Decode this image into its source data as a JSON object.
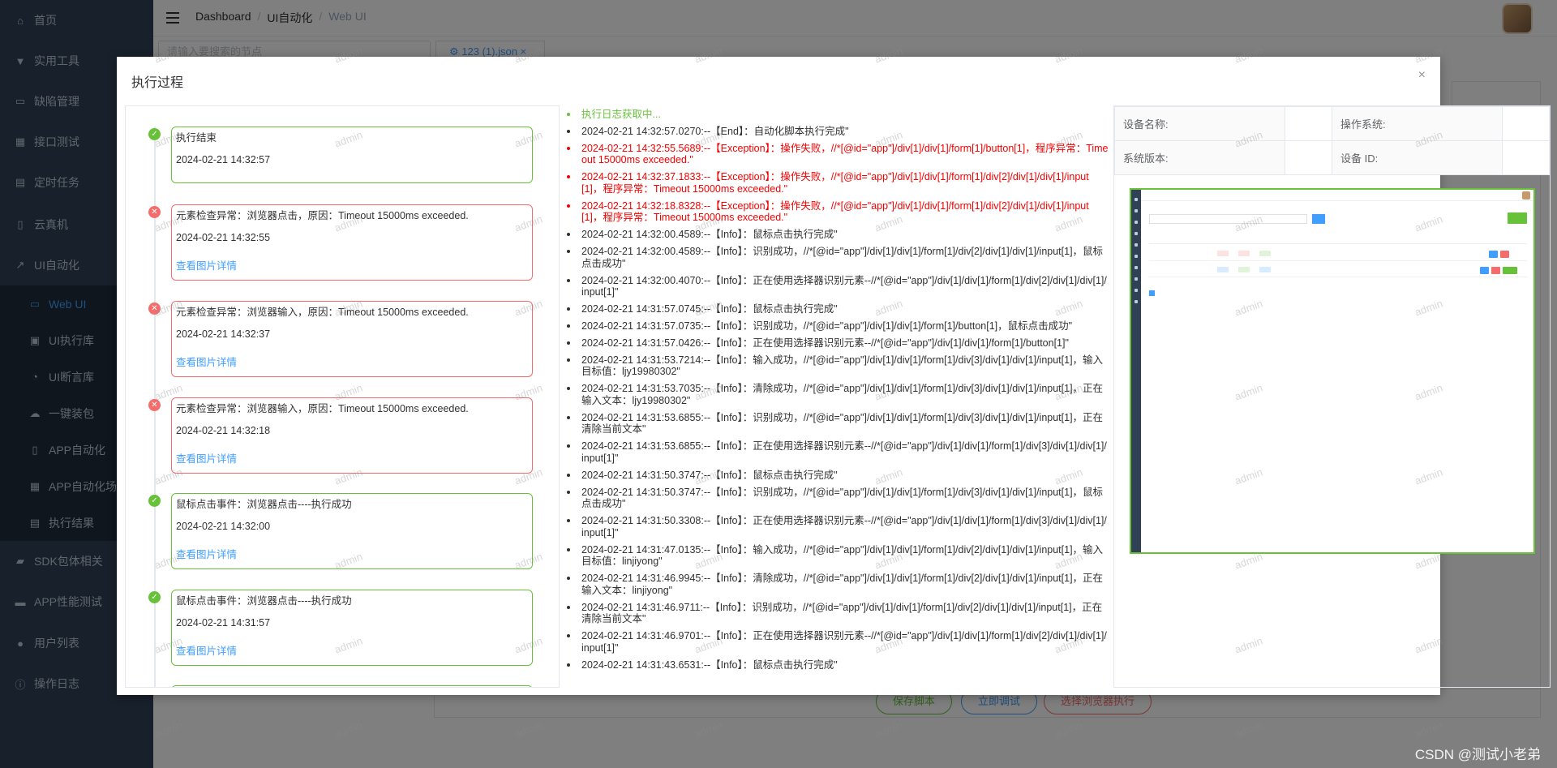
{
  "sidebar": {
    "items": [
      {
        "label": "首页",
        "icon": "home-icon"
      },
      {
        "label": "实用工具",
        "icon": "tools-icon"
      },
      {
        "label": "缺陷管理",
        "icon": "briefcase-icon"
      },
      {
        "label": "接口测试",
        "icon": "grid-icon"
      },
      {
        "label": "定时任务",
        "icon": "clipboard-icon"
      },
      {
        "label": "云真机",
        "icon": "mobile-icon"
      },
      {
        "label": "UI自动化",
        "icon": "chart-icon"
      },
      {
        "label": "Web UI",
        "icon": "monitor-icon"
      },
      {
        "label": "UI执行库",
        "icon": "image-icon"
      },
      {
        "label": "UI断言库",
        "icon": "gauge-icon"
      },
      {
        "label": "一键装包",
        "icon": "cloud-upload-icon"
      },
      {
        "label": "APP自动化",
        "icon": "phone-icon"
      },
      {
        "label": "APP自动化场景",
        "icon": "calendar-icon"
      },
      {
        "label": "执行结果",
        "icon": "clipboard-check-icon"
      },
      {
        "label": "SDK包体相关",
        "icon": "package-icon"
      },
      {
        "label": "APP性能测试",
        "icon": "screen-icon"
      },
      {
        "label": "用户列表",
        "icon": "user-icon"
      },
      {
        "label": "操作日志",
        "icon": "info-icon"
      }
    ]
  },
  "breadcrumb": {
    "items": [
      "Dashboard",
      "UI自动化",
      "Web UI"
    ]
  },
  "background": {
    "search_placeholder": "请输入要搜索的节点",
    "tab_label": "123 (1).json",
    "save_button": "保存脚本",
    "debug_button": "立即调试",
    "browser_button": "选择浏览器执行"
  },
  "watermark": "admin",
  "dialog": {
    "title": "执行过程",
    "close": "×",
    "timeline": [
      {
        "status": "ok",
        "title": "执行结束",
        "date": "2024-02-21 14:32:57",
        "link": ""
      },
      {
        "status": "err",
        "title": "元素检查异常：浏览器点击，原因：Timeout 15000ms exceeded.",
        "date": "2024-02-21 14:32:55",
        "link": "查看图片详情"
      },
      {
        "status": "err",
        "title": "元素检查异常：浏览器输入，原因：Timeout 15000ms exceeded.",
        "date": "2024-02-21 14:32:37",
        "link": "查看图片详情"
      },
      {
        "status": "err",
        "title": "元素检查异常：浏览器输入，原因：Timeout 15000ms exceeded.",
        "date": "2024-02-21 14:32:18",
        "link": "查看图片详情"
      },
      {
        "status": "ok",
        "title": "鼠标点击事件：浏览器点击----执行成功",
        "date": "2024-02-21 14:32:00",
        "link": "查看图片详情"
      },
      {
        "status": "ok",
        "title": "鼠标点击事件：浏览器点击----执行成功",
        "date": "2024-02-21 14:31:57",
        "link": "查看图片详情"
      }
    ],
    "logs": [
      {
        "type": "first",
        "text": "执行日志获取中..."
      },
      {
        "type": "info",
        "text": "2024-02-21 14:32:57.0270:--【End】：自动化脚本执行完成\""
      },
      {
        "type": "err",
        "text": "2024-02-21 14:32:55.5689:--【Exception】：操作失败，//*[@id=\"app\"]/div[1]/div[1]/form[1]/button[1]，程序异常：Timeout 15000ms exceeded.\""
      },
      {
        "type": "err",
        "text": "2024-02-21 14:32:37.1833:--【Exception】：操作失败，//*[@id=\"app\"]/div[1]/div[1]/form[1]/div[2]/div[1]/div[1]/input[1]，程序异常：Timeout 15000ms exceeded.\""
      },
      {
        "type": "err",
        "text": "2024-02-21 14:32:18.8328:--【Exception】：操作失败，//*[@id=\"app\"]/div[1]/div[1]/form[1]/div[2]/div[1]/div[1]/input[1]，程序异常：Timeout 15000ms exceeded.\""
      },
      {
        "type": "info",
        "text": "2024-02-21 14:32:00.4589:--【Info】：鼠标点击执行完成\""
      },
      {
        "type": "info",
        "text": "2024-02-21 14:32:00.4589:--【Info】：识别成功，//*[@id=\"app\"]/div[1]/div[1]/form[1]/div[2]/div[1]/div[1]/input[1]，鼠标点击成功\""
      },
      {
        "type": "info",
        "text": "2024-02-21 14:32:00.4070:--【Info】：正在使用选择器识别元素--//*[@id=\"app\"]/div[1]/div[1]/form[1]/div[2]/div[1]/div[1]/input[1]\""
      },
      {
        "type": "info",
        "text": "2024-02-21 14:31:57.0745:--【Info】：鼠标点击执行完成\""
      },
      {
        "type": "info",
        "text": "2024-02-21 14:31:57.0735:--【Info】：识别成功，//*[@id=\"app\"]/div[1]/div[1]/form[1]/button[1]，鼠标点击成功\""
      },
      {
        "type": "info",
        "text": "2024-02-21 14:31:57.0426:--【Info】：正在使用选择器识别元素--//*[@id=\"app\"]/div[1]/div[1]/form[1]/button[1]\""
      },
      {
        "type": "info",
        "text": "2024-02-21 14:31:53.7214:--【Info】：输入成功，//*[@id=\"app\"]/div[1]/div[1]/form[1]/div[3]/div[1]/div[1]/input[1]，输入目标值：ljy19980302\""
      },
      {
        "type": "info",
        "text": "2024-02-21 14:31:53.7035:--【Info】：清除成功，//*[@id=\"app\"]/div[1]/div[1]/form[1]/div[3]/div[1]/div[1]/input[1]，正在输入文本：ljy19980302\""
      },
      {
        "type": "info",
        "text": "2024-02-21 14:31:53.6855:--【Info】：识别成功，//*[@id=\"app\"]/div[1]/div[1]/form[1]/div[3]/div[1]/div[1]/input[1]，正在清除当前文本\""
      },
      {
        "type": "info",
        "text": "2024-02-21 14:31:53.6855:--【Info】：正在使用选择器识别元素--//*[@id=\"app\"]/div[1]/div[1]/form[1]/div[3]/div[1]/div[1]/input[1]\""
      },
      {
        "type": "info",
        "text": "2024-02-21 14:31:50.3747:--【Info】：鼠标点击执行完成\""
      },
      {
        "type": "info",
        "text": "2024-02-21 14:31:50.3747:--【Info】：识别成功，//*[@id=\"app\"]/div[1]/div[1]/form[1]/div[3]/div[1]/div[1]/input[1]，鼠标点击成功\""
      },
      {
        "type": "info",
        "text": "2024-02-21 14:31:50.3308:--【Info】：正在使用选择器识别元素--//*[@id=\"app\"]/div[1]/div[1]/form[1]/div[3]/div[1]/div[1]/input[1]\""
      },
      {
        "type": "info",
        "text": "2024-02-21 14:31:47.0135:--【Info】：输入成功，//*[@id=\"app\"]/div[1]/div[1]/form[1]/div[2]/div[1]/div[1]/input[1]，输入目标值：linjiyong\""
      },
      {
        "type": "info",
        "text": "2024-02-21 14:31:46.9945:--【Info】：清除成功，//*[@id=\"app\"]/div[1]/div[1]/form[1]/div[2]/div[1]/div[1]/input[1]，正在输入文本：linjiyong\""
      },
      {
        "type": "info",
        "text": "2024-02-21 14:31:46.9711:--【Info】：识别成功，//*[@id=\"app\"]/div[1]/div[1]/form[1]/div[2]/div[1]/div[1]/input[1]，正在清除当前文本\""
      },
      {
        "type": "info",
        "text": "2024-02-21 14:31:46.9701:--【Info】：正在使用选择器识别元素--//*[@id=\"app\"]/div[1]/div[1]/form[1]/div[2]/div[1]/div[1]/input[1]\""
      },
      {
        "type": "info",
        "text": "2024-02-21 14:31:43.6531:--【Info】：鼠标点击执行完成\""
      }
    ],
    "device": {
      "name_label": "设备名称:",
      "name_value": "",
      "os_label": "操作系统:",
      "os_value": "",
      "version_label": "系统版本:",
      "version_value": "",
      "id_label": "设备 ID:",
      "id_value": ""
    }
  },
  "footer_credit": "CSDN @测试小老弟",
  "colors": {
    "sidebar": "#304156",
    "accent": "#409eff",
    "success": "#67c23a",
    "danger": "#f56c6c",
    "error_text": "#f50000"
  }
}
